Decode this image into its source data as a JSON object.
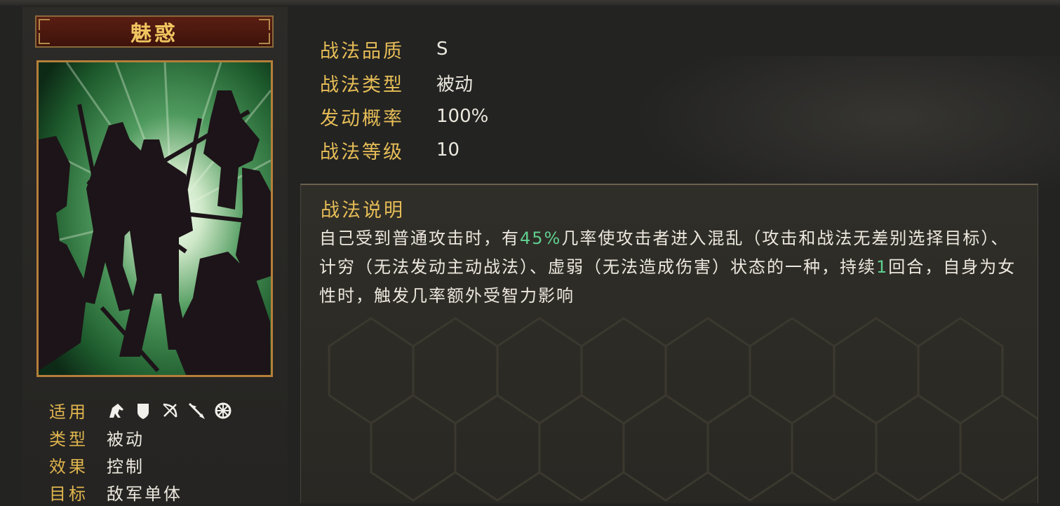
{
  "skill": {
    "name": "魅惑"
  },
  "attributes": [
    {
      "key": "战法品质",
      "value": "S"
    },
    {
      "key": "战法类型",
      "value": "被动"
    },
    {
      "key": "发动概率",
      "value": "100%"
    },
    {
      "key": "战法等级",
      "value": "10"
    }
  ],
  "description": {
    "title": "战法说明",
    "parts": [
      {
        "text": "自己受到普通攻击时，有",
        "highlight": false
      },
      {
        "text": "45%",
        "highlight": true
      },
      {
        "text": "几率使攻击者进入混乱（攻击和战法无差别选择目标）、计穷（无法发动主动战法）、虚弱（无法造成伤害）状态的一种，持续",
        "highlight": false
      },
      {
        "text": "1",
        "highlight": true
      },
      {
        "text": "回合，自身为女性时，触发几率额外受智力影响",
        "highlight": false
      }
    ]
  },
  "meta": {
    "applicable_label": "适用",
    "applicable_icons": [
      "cavalry-icon",
      "shield-icon",
      "bow-icon",
      "spear-icon",
      "siege-wheel-icon"
    ],
    "type_label": "类型",
    "type_value": "被动",
    "effect_label": "效果",
    "effect_value": "控制",
    "target_label": "目标",
    "target_value": "敌军单体"
  },
  "colors": {
    "label_gold": "#e6bd57",
    "highlight_green": "#5fcf8f",
    "title_red": "#5a1e12"
  }
}
